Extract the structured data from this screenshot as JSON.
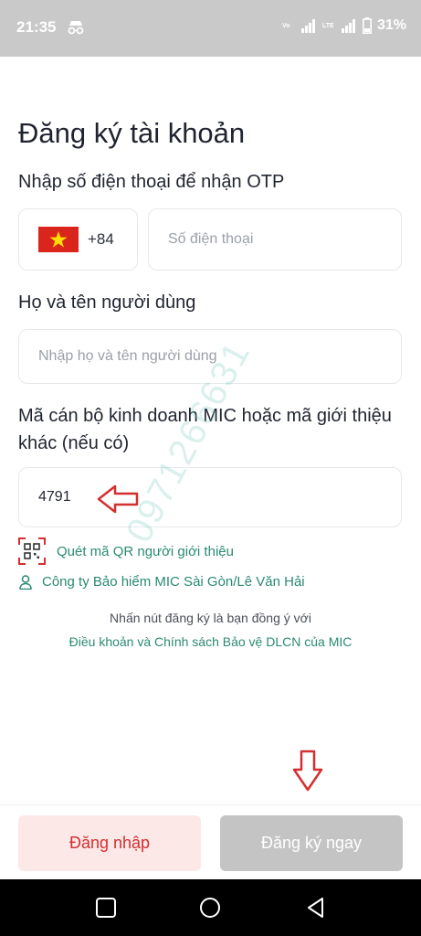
{
  "status_bar": {
    "time": "21:35",
    "net_label_1": "Vo",
    "net_label_2": "LTE",
    "battery": "31%"
  },
  "page": {
    "title": "Đăng ký tài khoản"
  },
  "phone": {
    "label": "Nhập số điện thoại để nhận OTP",
    "country_code": "+84",
    "placeholder": "Số điện thoại"
  },
  "name": {
    "label": "Họ và tên người dùng",
    "placeholder": "Nhập họ và tên người dùng"
  },
  "referral": {
    "label": "Mã cán bộ kinh doanh MIC hoặc mã giới thiệu khác (nếu có)",
    "value": "4791"
  },
  "links": {
    "scan_qr": "Quét mã QR người giới thiệu",
    "company": "Công ty Bảo hiểm MIC Sài Gòn/Lê Văn Hải"
  },
  "terms": {
    "text": "Nhấn nút đăng ký là bạn đồng ý với",
    "link": "Điều khoản và Chính sách Bảo vệ DLCN của MIC"
  },
  "watermark": "0971266631",
  "buttons": {
    "login": "Đăng nhập",
    "register": "Đăng ký ngay"
  },
  "colors": {
    "accent_green": "#2a8a72",
    "login_red": "#d32f2f",
    "login_bg": "#fde8e8",
    "register_disabled_bg": "#c4c4c4",
    "annotation_arrow": "#d32f2f"
  },
  "icons": {
    "flag": "vietnam-flag-icon",
    "qr": "qr-code-icon",
    "user": "user-icon",
    "nav": [
      "recent-apps-icon",
      "home-icon",
      "back-icon"
    ]
  }
}
